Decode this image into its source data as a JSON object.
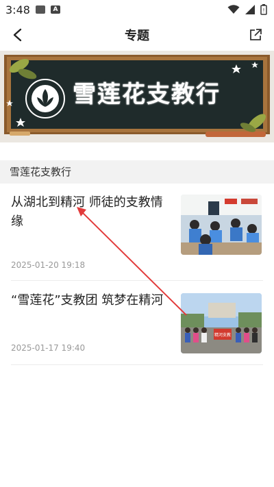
{
  "status_bar": {
    "time": "3:48"
  },
  "header": {
    "title": "专题"
  },
  "banner": {
    "title": "雪莲花支教行"
  },
  "section": {
    "title": "雪莲花支教行"
  },
  "articles": [
    {
      "headline": "从湖北到精河 师徒的支教情缘",
      "date": "2025-01-20 19:18"
    },
    {
      "headline": "“雪莲花”支教团 筑梦在精河",
      "date": "2025-01-17 19:40"
    }
  ],
  "thumb2": {
    "banner_text": "精河支教"
  },
  "colors": {
    "chalkboard": "#1f2b2b",
    "frame": "#8a5a2b",
    "annotation_arrow": "#e23b3b"
  }
}
